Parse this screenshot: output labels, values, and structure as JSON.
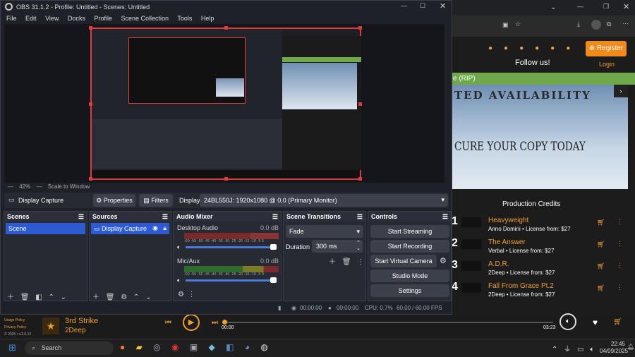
{
  "obs": {
    "title": "OBS 31.1.2 - Profile: Untitled - Scenes: Untitled",
    "menu": [
      "File",
      "Edit",
      "View",
      "Docks",
      "Profile",
      "Scene Collection",
      "Tools",
      "Help"
    ],
    "zoom": "42%",
    "scale_label": "Scale to Window",
    "source_toolbar": {
      "source_name": "Display Capture",
      "properties": "Properties",
      "filters": "Filters",
      "display_label": "Display",
      "display_value": "24BL550J: 1920x1080 @ 0,0 (Primary Monitor)"
    },
    "scenes": {
      "title": "Scenes",
      "items": [
        "Scene"
      ]
    },
    "sources": {
      "title": "Sources",
      "items": [
        "Display Capture"
      ]
    },
    "mixer": {
      "title": "Audio Mixer",
      "channels": [
        {
          "name": "Desktop Audio",
          "db": "0.0 dB"
        },
        {
          "name": "Mic/Aux",
          "db": "0.0 dB"
        }
      ],
      "scale": [
        "-60",
        "-55",
        "-50",
        "-45",
        "-40",
        "-35",
        "-30",
        "-25",
        "-20",
        "-15",
        "-10",
        "-5",
        "0"
      ]
    },
    "transitions": {
      "title": "Scene Transitions",
      "type": "Fade",
      "duration_label": "Duration",
      "duration": "300 ms"
    },
    "controls": {
      "title": "Controls",
      "start_streaming": "Start Streaming",
      "start_recording": "Start Recording",
      "start_virtual_camera": "Start Virtual Camera",
      "studio_mode": "Studio Mode",
      "settings": "Settings"
    },
    "status": {
      "stream_time": "00:00:00",
      "rec_time": "00:00:00",
      "cpu": "CPU: 0.7%",
      "fps": "60.00 / 60.00 FPS"
    }
  },
  "browser": {
    "register": "Register",
    "follow": "Follow us!",
    "login": "Login",
    "banner_partial": "e (RIP)",
    "hero_line1": "TED AVAILABILITY",
    "hero_line2": "CURE YOUR COPY TODAY",
    "credits_title": "Production Credits",
    "credits": [
      {
        "num": "1",
        "title": "Heavyweight",
        "sub": "Anno Domini  • License from: $27"
      },
      {
        "num": "2",
        "title": "The Answer",
        "sub": "Verbal  • License from: $27"
      },
      {
        "num": "3",
        "title": "A.D.R.",
        "sub": "2Deep  • License from: $27"
      },
      {
        "num": "4",
        "title": "Fall From Grace Pt.2",
        "sub": "2Deep  • License from: $27"
      }
    ]
  },
  "player": {
    "track": "3rd Strike",
    "artist": "2Deep",
    "time_current": "00:00",
    "time_total": "03:23",
    "left_links": [
      "Usage Policy",
      "Privacy Policy",
      "© 2025 • v.2.0.12"
    ]
  },
  "taskbar": {
    "search_placeholder": "Search",
    "time": "22:45",
    "date": "04/09/2025"
  },
  "colors": {
    "accent": "#f0a030",
    "obs_selected": "#2c5bd4",
    "record_red": "#e03a3a"
  }
}
